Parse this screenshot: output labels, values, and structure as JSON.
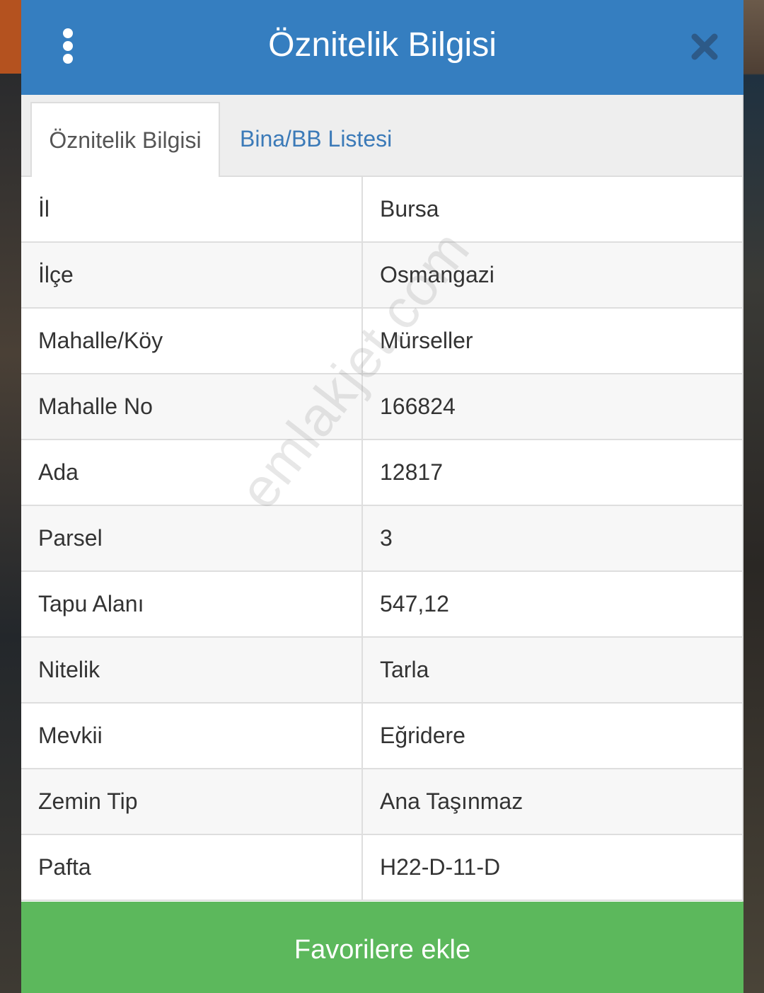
{
  "header": {
    "title": "Öznitelik Bilgisi"
  },
  "tabs": [
    {
      "label": "Öznitelik Bilgisi",
      "active": true
    },
    {
      "label": "Bina/BB Listesi",
      "active": false
    }
  ],
  "rows": [
    {
      "label": "İl",
      "value": "Bursa"
    },
    {
      "label": "İlçe",
      "value": "Osmangazi"
    },
    {
      "label": "Mahalle/Köy",
      "value": "Mürseller"
    },
    {
      "label": "Mahalle No",
      "value": "166824"
    },
    {
      "label": "Ada",
      "value": "12817"
    },
    {
      "label": "Parsel",
      "value": "3"
    },
    {
      "label": "Tapu Alanı",
      "value": "547,12"
    },
    {
      "label": "Nitelik",
      "value": "Tarla"
    },
    {
      "label": "Mevkii",
      "value": "Eğridere"
    },
    {
      "label": "Zemin Tip",
      "value": "Ana Taşınmaz"
    },
    {
      "label": "Pafta",
      "value": "H22-D-11-D"
    }
  ],
  "watermark": "emlakjet.com",
  "footer": {
    "favorite_label": "Favorilere ekle"
  },
  "colors": {
    "header": "#357ec0",
    "button": "#5cb85c",
    "tab_link": "#3b7ab8"
  },
  "icons": {
    "menu": "more-vertical-icon",
    "close": "close-icon"
  }
}
